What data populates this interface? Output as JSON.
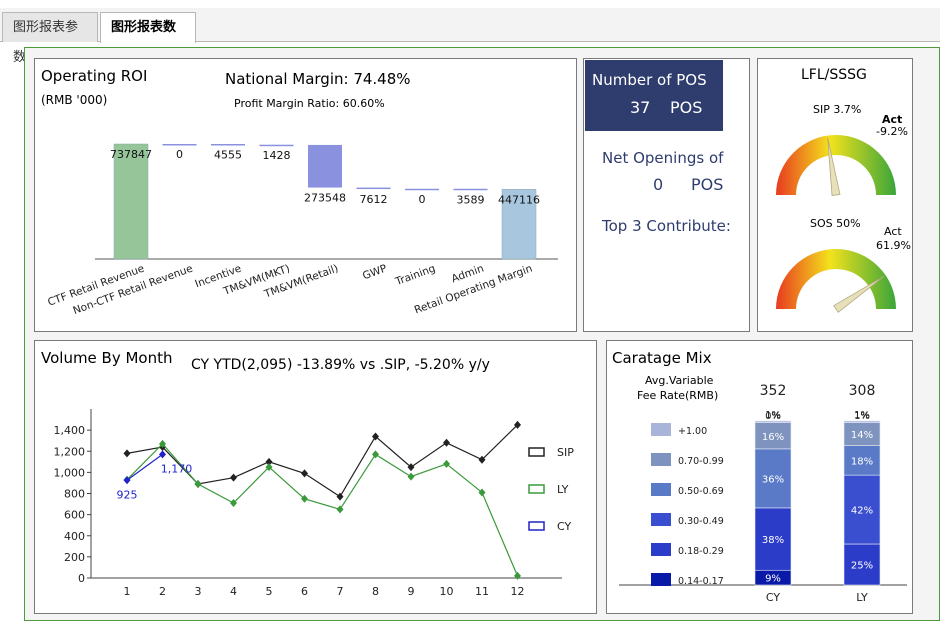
{
  "tabs": [
    {
      "label": "图形报表参数",
      "active": false
    },
    {
      "label": "图形报表数据",
      "active": true
    }
  ],
  "roi": {
    "title": "Operating ROI",
    "unit": "(RMB '000)",
    "national_margin": "National Margin: 74.48%",
    "profit_margin": "Profit Margin Ratio: 60.60%"
  },
  "pos": {
    "title": "Number of POS",
    "count": "37",
    "unit": "POS",
    "net_title": "Net Openings of",
    "net_count": "0",
    "net_unit": "POS",
    "top3": "Top 3 Contribute:"
  },
  "lfl": {
    "title": "LFL/SSSG",
    "gauges": [
      {
        "target_label": "SIP 3.7%",
        "act_label": "Act",
        "act_value": "-9.2%",
        "act_pct": -9.2
      },
      {
        "target_label": "SOS 50%",
        "act_label": "Act",
        "act_value": "61.9%",
        "act_pct": 61.9
      }
    ]
  },
  "volume": {
    "title": "Volume By Month",
    "subtitle": "CY YTD(2,095) -13.89% vs .SIP, -5.20% y/y"
  },
  "caratage": {
    "title": "Caratage Mix",
    "subtitle_line1": "Avg.Variable",
    "subtitle_line2": "Fee Rate(RMB)"
  },
  "colors": {
    "accent_green": "#4e9a3a",
    "pos_box": "#2f3d6e",
    "waterfall_green": "#96c59a",
    "waterfall_purple": "#8a92e0",
    "waterfall_blue": "#a8c6de",
    "sip": "#222222",
    "ly": "#3a9a3a",
    "cy": "#2222cc"
  },
  "chart_data": [
    {
      "type": "bar",
      "subtype": "waterfall",
      "categories": [
        "CTF Retail Revenue",
        "Non-CTF Retail Revenue",
        "Incentive",
        "TM&VM(MKT)",
        "TM&VM(Retail)",
        "GWP",
        "Training",
        "Admin",
        "Retail Operating Margin"
      ],
      "values": [
        737847,
        0,
        4555,
        1428,
        273548,
        7612,
        0,
        3589,
        447116
      ],
      "labels": [
        "737847",
        "0",
        "4555",
        "1428",
        "273548",
        "7612",
        "0",
        "3589",
        "447116"
      ],
      "kinds": [
        "total",
        "increase",
        "decrease",
        "decrease",
        "decrease",
        "decrease",
        "decrease",
        "decrease",
        "total"
      ]
    },
    {
      "type": "line",
      "x": [
        1,
        2,
        3,
        4,
        5,
        6,
        7,
        8,
        9,
        10,
        11,
        12
      ],
      "xticks": [
        "1",
        "2",
        "3",
        "4",
        "5",
        "6",
        "7",
        "8",
        "9",
        "10",
        "11",
        "12"
      ],
      "yticks": [
        "0",
        "200",
        "400",
        "600",
        "800",
        "1,000",
        "1,200",
        "1,400"
      ],
      "ylim": [
        0,
        1600
      ],
      "legend_position": "right",
      "series": [
        {
          "name": "SIP",
          "values": [
            1180,
            1240,
            890,
            950,
            1100,
            990,
            770,
            1340,
            1050,
            1280,
            1120,
            1450
          ]
        },
        {
          "name": "LY",
          "values": [
            930,
            1270,
            890,
            710,
            1050,
            750,
            650,
            1170,
            960,
            1080,
            810,
            20
          ]
        },
        {
          "name": "CY",
          "values": [
            925,
            1170,
            null,
            null,
            null,
            null,
            null,
            null,
            null,
            null,
            null,
            null
          ]
        }
      ],
      "data_labels": [
        {
          "series": "CY",
          "x": 1,
          "text": "925"
        },
        {
          "series": "CY",
          "x": 2,
          "text": "1,170"
        }
      ]
    },
    {
      "type": "bar",
      "subtype": "stacked-100",
      "categories": [
        "CY",
        "LY"
      ],
      "totals": [
        "352",
        "308"
      ],
      "legend_position": "left",
      "series": [
        {
          "name": "0.14-0.17",
          "color": "#0a1aa8",
          "values": [
            9,
            0
          ],
          "labels": [
            "9%",
            ""
          ]
        },
        {
          "name": "0.18-0.29",
          "color": "#2a3cc8",
          "values": [
            38,
            25
          ],
          "labels": [
            "38%",
            "25%"
          ]
        },
        {
          "name": "0.30-0.49",
          "color": "#3a4fd0",
          "values": [
            0,
            42
          ],
          "labels": [
            "",
            "42%"
          ]
        },
        {
          "name": "0.50-0.69",
          "color": "#5a7ac8",
          "values": [
            36,
            18
          ],
          "labels": [
            "36%",
            "18%"
          ]
        },
        {
          "name": "0.70-0.99",
          "color": "#7f93bf",
          "values": [
            16,
            14
          ],
          "labels": [
            "16%",
            "14%"
          ]
        },
        {
          "name": "+1.00",
          "color": "#a9b5d8",
          "values": [
            1,
            1
          ],
          "labels": [
            "1%",
            "1%"
          ]
        }
      ],
      "zero_labels": [
        "0%",
        "1%"
      ]
    }
  ]
}
